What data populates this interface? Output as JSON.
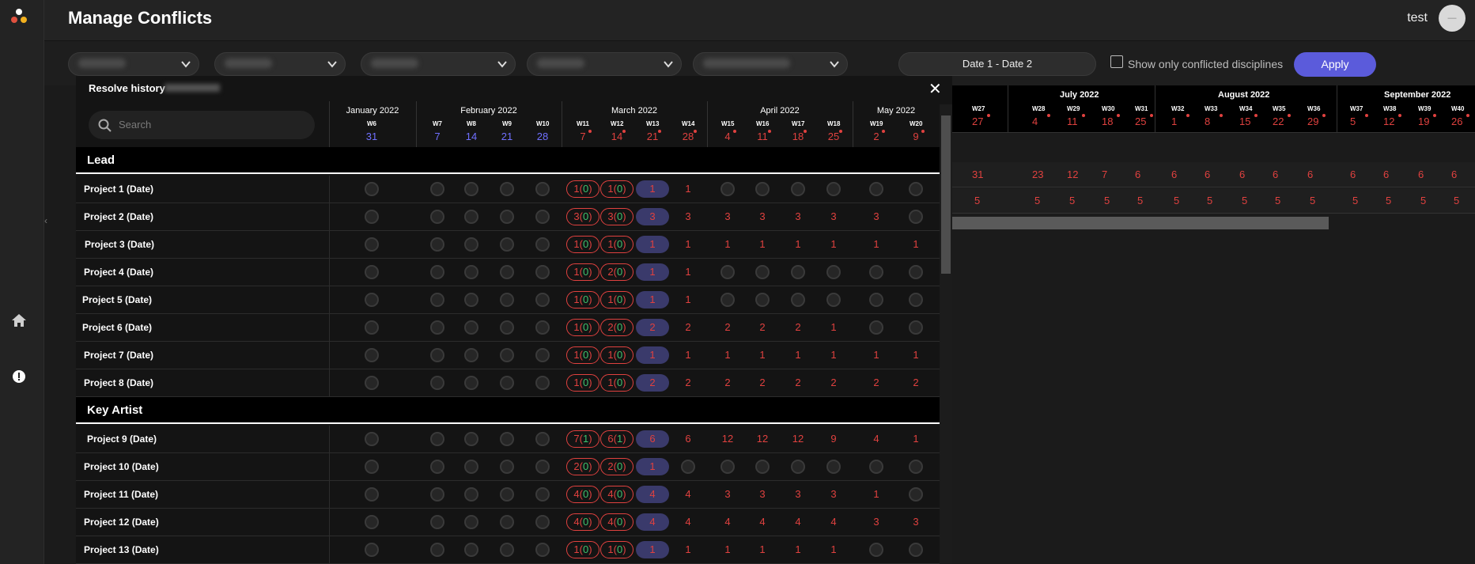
{
  "app": {
    "title": "Manage Conflicts",
    "user": "test",
    "avatar_text": "—"
  },
  "filters": {
    "date_range": "Date 1 - Date 2",
    "checkbox_label": "Show only conflicted disciplines",
    "apply": "Apply"
  },
  "background_timeline": {
    "months": [
      "July 2022",
      "August 2022",
      "September 2022"
    ],
    "weeks": [
      "W27",
      "W28",
      "W29",
      "W30",
      "W31",
      "W32",
      "W33",
      "W34",
      "W35",
      "W36",
      "W37",
      "W38",
      "W39",
      "W40"
    ],
    "days": [
      "27",
      "4",
      "11",
      "18",
      "25",
      "1",
      "8",
      "15",
      "22",
      "29",
      "5",
      "12",
      "19",
      "26"
    ],
    "row1": [
      "31",
      "23",
      "12",
      "7",
      "6",
      "6",
      "6",
      "6",
      "6",
      "6",
      "6",
      "6",
      "6",
      "6"
    ],
    "row2": [
      "5",
      "5",
      "5",
      "5",
      "5",
      "5",
      "5",
      "5",
      "5",
      "5",
      "5",
      "5",
      "5",
      "5"
    ]
  },
  "modal": {
    "title": "Resolve history",
    "search_placeholder": "Search",
    "months": [
      "January 2022",
      "February 2022",
      "March 2022",
      "April 2022",
      "May 2022"
    ],
    "weeks": [
      "W6",
      "W7",
      "W8",
      "W9",
      "W10",
      "W11",
      "W12",
      "W13",
      "W14",
      "W15",
      "W16",
      "W17",
      "W18",
      "W19",
      "W20"
    ],
    "days": [
      "31",
      "7",
      "14",
      "21",
      "28",
      "7",
      "14",
      "21",
      "28",
      "4",
      "11",
      "18",
      "25",
      "2",
      "9"
    ],
    "sections": [
      {
        "name": "Lead",
        "rows": [
          {
            "label": "Project 1 (Date)",
            "p1": "1",
            "p1b": "0",
            "p2": "1",
            "p2b": "0",
            "b": "1",
            "vals": [
              "1",
              "",
              "",
              "",
              "",
              "",
              "",
              ""
            ]
          },
          {
            "label": "Project 2 (Date)",
            "p1": "3",
            "p1b": "0",
            "p2": "3",
            "p2b": "0",
            "b": "3",
            "vals": [
              "3",
              "3",
              "3",
              "3",
              "3",
              "3",
              ""
            ]
          },
          {
            "label": "Project 3 (Date)",
            "p1": "1",
            "p1b": "0",
            "p2": "1",
            "p2b": "0",
            "b": "1",
            "vals": [
              "1",
              "1",
              "1",
              "1",
              "1",
              "1",
              "1"
            ]
          },
          {
            "label": "Project 4 (Date)",
            "p1": "1",
            "p1b": "0",
            "p2": "2",
            "p2b": "0",
            "b": "1",
            "vals": [
              "1",
              "",
              "",
              "",
              "",
              "",
              ""
            ]
          },
          {
            "label": "Project 5 (Date)",
            "p1": "1",
            "p1b": "0",
            "p2": "1",
            "p2b": "0",
            "b": "1",
            "vals": [
              "1",
              "",
              "",
              "",
              "",
              "",
              ""
            ]
          },
          {
            "label": "Project 6 (Date)",
            "p1": "1",
            "p1b": "0",
            "p2": "2",
            "p2b": "0",
            "b": "2",
            "vals": [
              "2",
              "2",
              "2",
              "2",
              "1",
              "",
              ""
            ]
          },
          {
            "label": "Project 7 (Date)",
            "p1": "1",
            "p1b": "0",
            "p2": "1",
            "p2b": "0",
            "b": "1",
            "vals": [
              "1",
              "1",
              "1",
              "1",
              "1",
              "1",
              "1"
            ]
          },
          {
            "label": "Project 8 (Date)",
            "p1": "1",
            "p1b": "0",
            "p2": "1",
            "p2b": "0",
            "b": "2",
            "vals": [
              "2",
              "2",
              "2",
              "2",
              "2",
              "2",
              "2"
            ]
          }
        ]
      },
      {
        "name": "Key Artist",
        "rows": [
          {
            "label": "Project 9 (Date)",
            "p1": "7",
            "p1b": "1",
            "p2": "6",
            "p2b": "1",
            "b": "6",
            "vals": [
              "6",
              "12",
              "12",
              "12",
              "9",
              "4",
              "1"
            ]
          },
          {
            "label": "Project 10 (Date)",
            "p1": "2",
            "p1b": "0",
            "p2": "2",
            "p2b": "0",
            "b": "1",
            "vals": [
              "",
              "",
              "",
              "",
              "",
              "",
              ""
            ]
          },
          {
            "label": "Project 11 (Date)",
            "p1": "4",
            "p1b": "0",
            "p2": "4",
            "p2b": "0",
            "b": "4",
            "vals": [
              "4",
              "3",
              "3",
              "3",
              "3",
              "1",
              ""
            ]
          },
          {
            "label": "Project 12 (Date)",
            "p1": "4",
            "p1b": "0",
            "p2": "4",
            "p2b": "0",
            "b": "4",
            "vals": [
              "4",
              "4",
              "4",
              "4",
              "4",
              "3",
              "3"
            ]
          },
          {
            "label": "Project 13 (Date)",
            "p1": "1",
            "p1b": "0",
            "p2": "1",
            "p2b": "0",
            "b": "1",
            "vals": [
              "1",
              "1",
              "1",
              "1",
              "1",
              "",
              ""
            ]
          }
        ]
      }
    ]
  },
  "colors": {
    "accent": "#5b5bdb",
    "conflict": "#e0413f",
    "ok": "#3ec16d",
    "blue_date": "#7070ff"
  }
}
